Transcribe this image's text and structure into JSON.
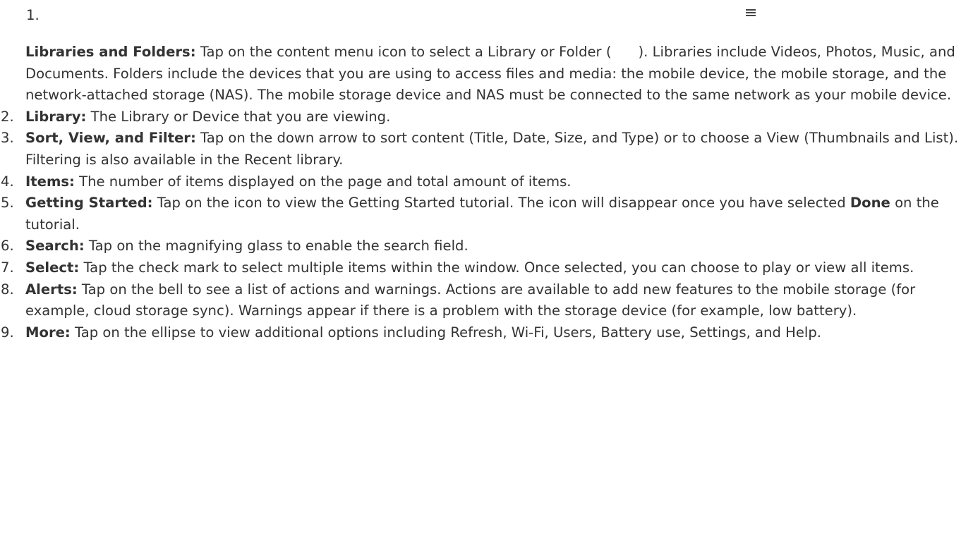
{
  "items": [
    {
      "number": "1.",
      "title": "Libraries and Folders:",
      "text_a": " Tap on the content menu icon to select a Library or Folder (",
      "text_b": "). Libraries include Videos, Photos, Music, and Documents. Folders include the devices that you are using to access files and media: the mobile device, the mobile storage, and the network-attached storage (NAS). The mobile storage device and NAS must be connected to the same network as your mobile device.",
      "icon": "menu-icon"
    },
    {
      "number": "2.",
      "title": "Library:",
      "text": " The Library or Device that you are viewing."
    },
    {
      "number": "3.",
      "title": "Sort, View, and Filter:",
      "text": " Tap on the down arrow to sort content (Title, Date, Size, and Type) or to choose a View (Thumbnails and List). Filtering is also available in the Recent library."
    },
    {
      "number": "4.",
      "title": "Items:",
      "text": " The number of items displayed on the page and total amount of items."
    },
    {
      "number": "5.",
      "title": "Getting Started:",
      "text_a": " Tap on the icon to view the Getting Started tutorial. The icon will disappear once you have selected ",
      "emph": "Done",
      "text_b": " on the tutorial."
    },
    {
      "number": "6.",
      "title": "Search:",
      "text": " Tap on the magnifying glass to enable the search field."
    },
    {
      "number": "7.",
      "title": "Select:",
      "text": " Tap the check mark to select multiple items within the window. Once selected, you can choose to play or view all items."
    },
    {
      "number": "8.",
      "title": "Alerts:",
      "text": " Tap on the bell to see a list of actions and warnings. Actions are available to add new features to the mobile storage (for example, cloud storage sync). Warnings appear if there is a problem with the storage device (for example, low battery)."
    },
    {
      "number": "9.",
      "title": "More:",
      "text": " Tap on the ellipse to view additional options including Refresh, Wi-Fi, Users, Battery use, Settings, and Help."
    }
  ]
}
